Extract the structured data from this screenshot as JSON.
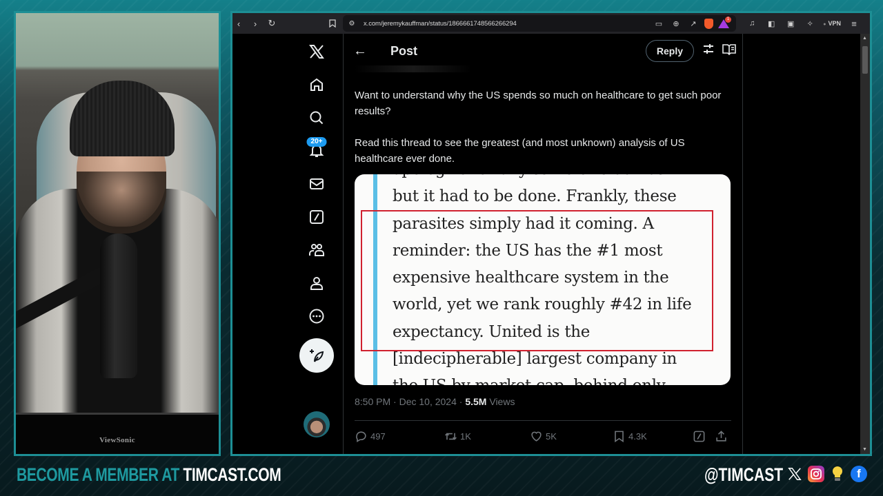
{
  "webcam": {
    "monitor_brand": "ViewSonic"
  },
  "browser": {
    "url": "x.com/jeremykauffman/status/1866661748566266294",
    "vpn_label": "VPN",
    "rewards_badge": "1",
    "icons": {
      "back": "chevron-left-icon",
      "forward": "chevron-right-icon",
      "reload": "reload-icon",
      "bookmark": "bookmark-icon",
      "site_settings": "site-settings-icon",
      "cast": "cast-icon",
      "zoom": "zoom-icon",
      "share": "share-icon",
      "brave_shields": "brave-shields-icon",
      "rewards": "brave-rewards-icon",
      "music": "music-icon",
      "sidebar": "sidebar-icon",
      "wallet": "wallet-icon",
      "leo": "leo-ai-icon",
      "menu": "hamburger-menu-icon"
    }
  },
  "x": {
    "nav": {
      "items": [
        {
          "name": "home",
          "icon": "home-icon"
        },
        {
          "name": "explore",
          "icon": "search-icon"
        },
        {
          "name": "notifications",
          "icon": "bell-icon",
          "badge": "20+"
        },
        {
          "name": "messages",
          "icon": "mail-icon"
        },
        {
          "name": "grok",
          "icon": "grok-icon"
        },
        {
          "name": "communities",
          "icon": "communities-icon"
        },
        {
          "name": "profile",
          "icon": "profile-icon"
        },
        {
          "name": "more",
          "icon": "more-icon"
        }
      ],
      "compose_icon": "compose-post-icon"
    },
    "header": {
      "title": "Post",
      "reply_label": "Reply"
    },
    "tweet": {
      "paragraphs": [
        "Want to understand why the US spends so much on healthcare to get such poor results?",
        "Read this thread to see the greatest (and most unknown) analysis of US healthcare ever done."
      ],
      "image_lines": [
        "apologize for any strife or traumas",
        "but it had to be done. Frankly, these",
        "parasites simply had it coming. A",
        "reminder: the US has the #1 most",
        "expensive healthcare system in the",
        "world, yet we rank roughly #42 in life",
        "expectancy. United is the",
        "[indecipherable] largest company in",
        "the US by market cap, behind only"
      ],
      "time": "8:50 PM",
      "date": "Dec 10, 2024",
      "views_count": "5.5M",
      "views_label": "Views",
      "stats": {
        "replies": "497",
        "reposts": "1K",
        "likes": "5K",
        "bookmarks": "4.3K"
      }
    }
  },
  "branding": {
    "cta_prefix": "BECOME A MEMBER AT ",
    "cta_site": "TIMCAST.COM",
    "handle": "@TIMCAST",
    "social_icons": [
      "x-icon",
      "instagram-icon",
      "lightbulb-icon",
      "facebook-icon"
    ]
  },
  "colors": {
    "frame_teal": "#1d8f95",
    "x_blue": "#1d9bf0",
    "highlight_red": "#d0202e",
    "quote_bar": "#5bbfe6"
  }
}
